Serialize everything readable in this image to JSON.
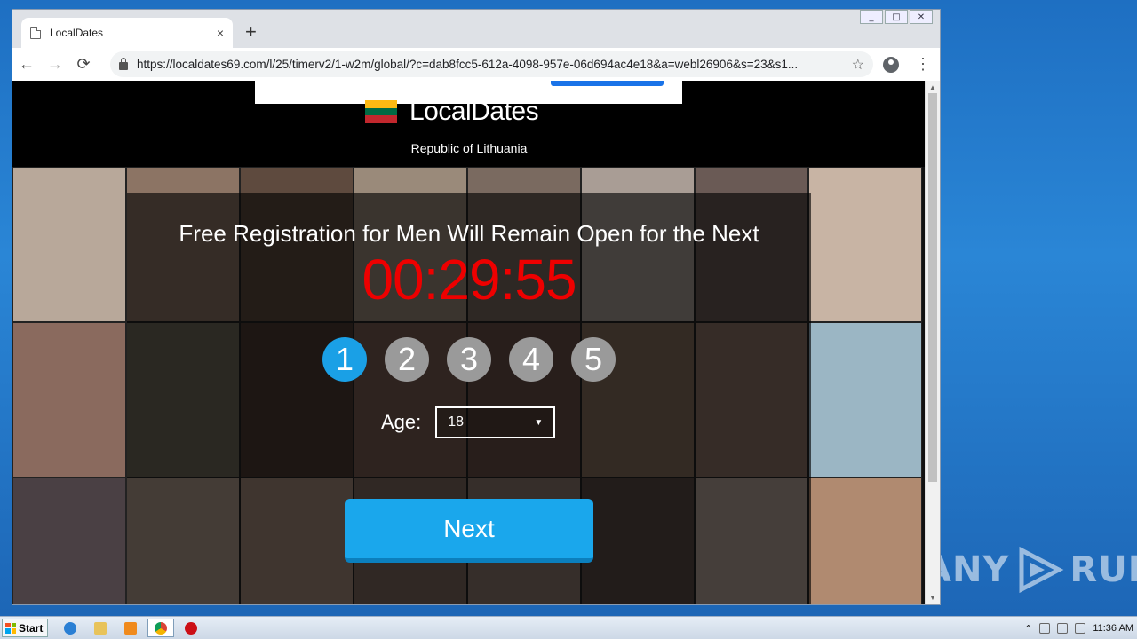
{
  "browser": {
    "tab_title": "LocalDates",
    "tab_close": "×",
    "new_tab": "+",
    "url": "https://localdates69.com/l/25/timerv2/1-w2m/global/?c=dab8fcc5-612a-4098-957e-06d694ac4e18&a=webl26906&s=23&s1...",
    "back": "←",
    "forward": "→",
    "reload": "⟳",
    "star": "☆",
    "menu": "⋮",
    "win_min": "_",
    "win_max": "□",
    "win_close": "✕"
  },
  "site": {
    "logo_text": "LocalDates",
    "country": "Republic of Lithuania",
    "flag_colors": [
      "#FDB913",
      "#006A44",
      "#C1272D"
    ]
  },
  "registration": {
    "headline": "Free Registration for Men Will Remain Open for the Next",
    "timer": "00:29:55",
    "steps": [
      "1",
      "2",
      "3",
      "4",
      "5"
    ],
    "active_step": "1",
    "age_label": "Age:",
    "age_value": "18",
    "next_label": "Next",
    "accent_color": "#1AA0E6",
    "timer_color": "#E00000"
  },
  "taskbar": {
    "start_label": "Start",
    "clock": "11:36 AM"
  },
  "watermark": {
    "text_left": "ANY",
    "text_right": "RUN"
  }
}
